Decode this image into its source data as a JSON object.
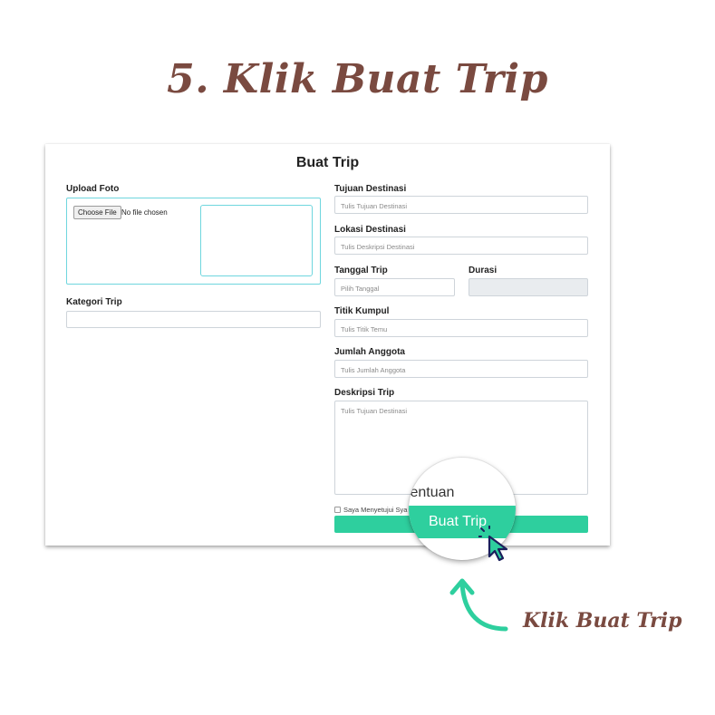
{
  "step_title": "5. Klik Buat Trip",
  "form": {
    "title": "Buat Trip",
    "upload": {
      "label": "Upload Foto",
      "button": "Choose File",
      "status": "No file chosen"
    },
    "kategori": {
      "label": "Kategori Trip",
      "value": ""
    },
    "tujuan": {
      "label": "Tujuan Destinasi",
      "placeholder": "Tulis Tujuan Destinasi"
    },
    "lokasi": {
      "label": "Lokasi Destinasi",
      "placeholder": "Tulis Deskripsi Destinasi"
    },
    "tanggal": {
      "label": "Tanggal Trip",
      "placeholder": "Pilih Tanggal"
    },
    "durasi": {
      "label": "Durasi",
      "value": ""
    },
    "titik": {
      "label": "Titik Kumpul",
      "placeholder": "Tulis Titik Temu"
    },
    "jumlah": {
      "label": "Jumlah Anggota",
      "placeholder": "Tulis Jumlah Anggota"
    },
    "deskripsi": {
      "label": "Deskripsi Trip",
      "placeholder": "Tulis Tujuan Destinasi"
    },
    "agree_text": "Saya Menyetujui Sya",
    "submit_label": ""
  },
  "magnifier": {
    "text": "tentuan",
    "button_label": "Buat Trip"
  },
  "annotation": {
    "text": "Klik Buat Trip"
  },
  "colors": {
    "accent": "#2ecf9e",
    "title_brown": "#7a4a40",
    "upload_border": "#6fd6de",
    "cursor": "#1a1f5c"
  }
}
